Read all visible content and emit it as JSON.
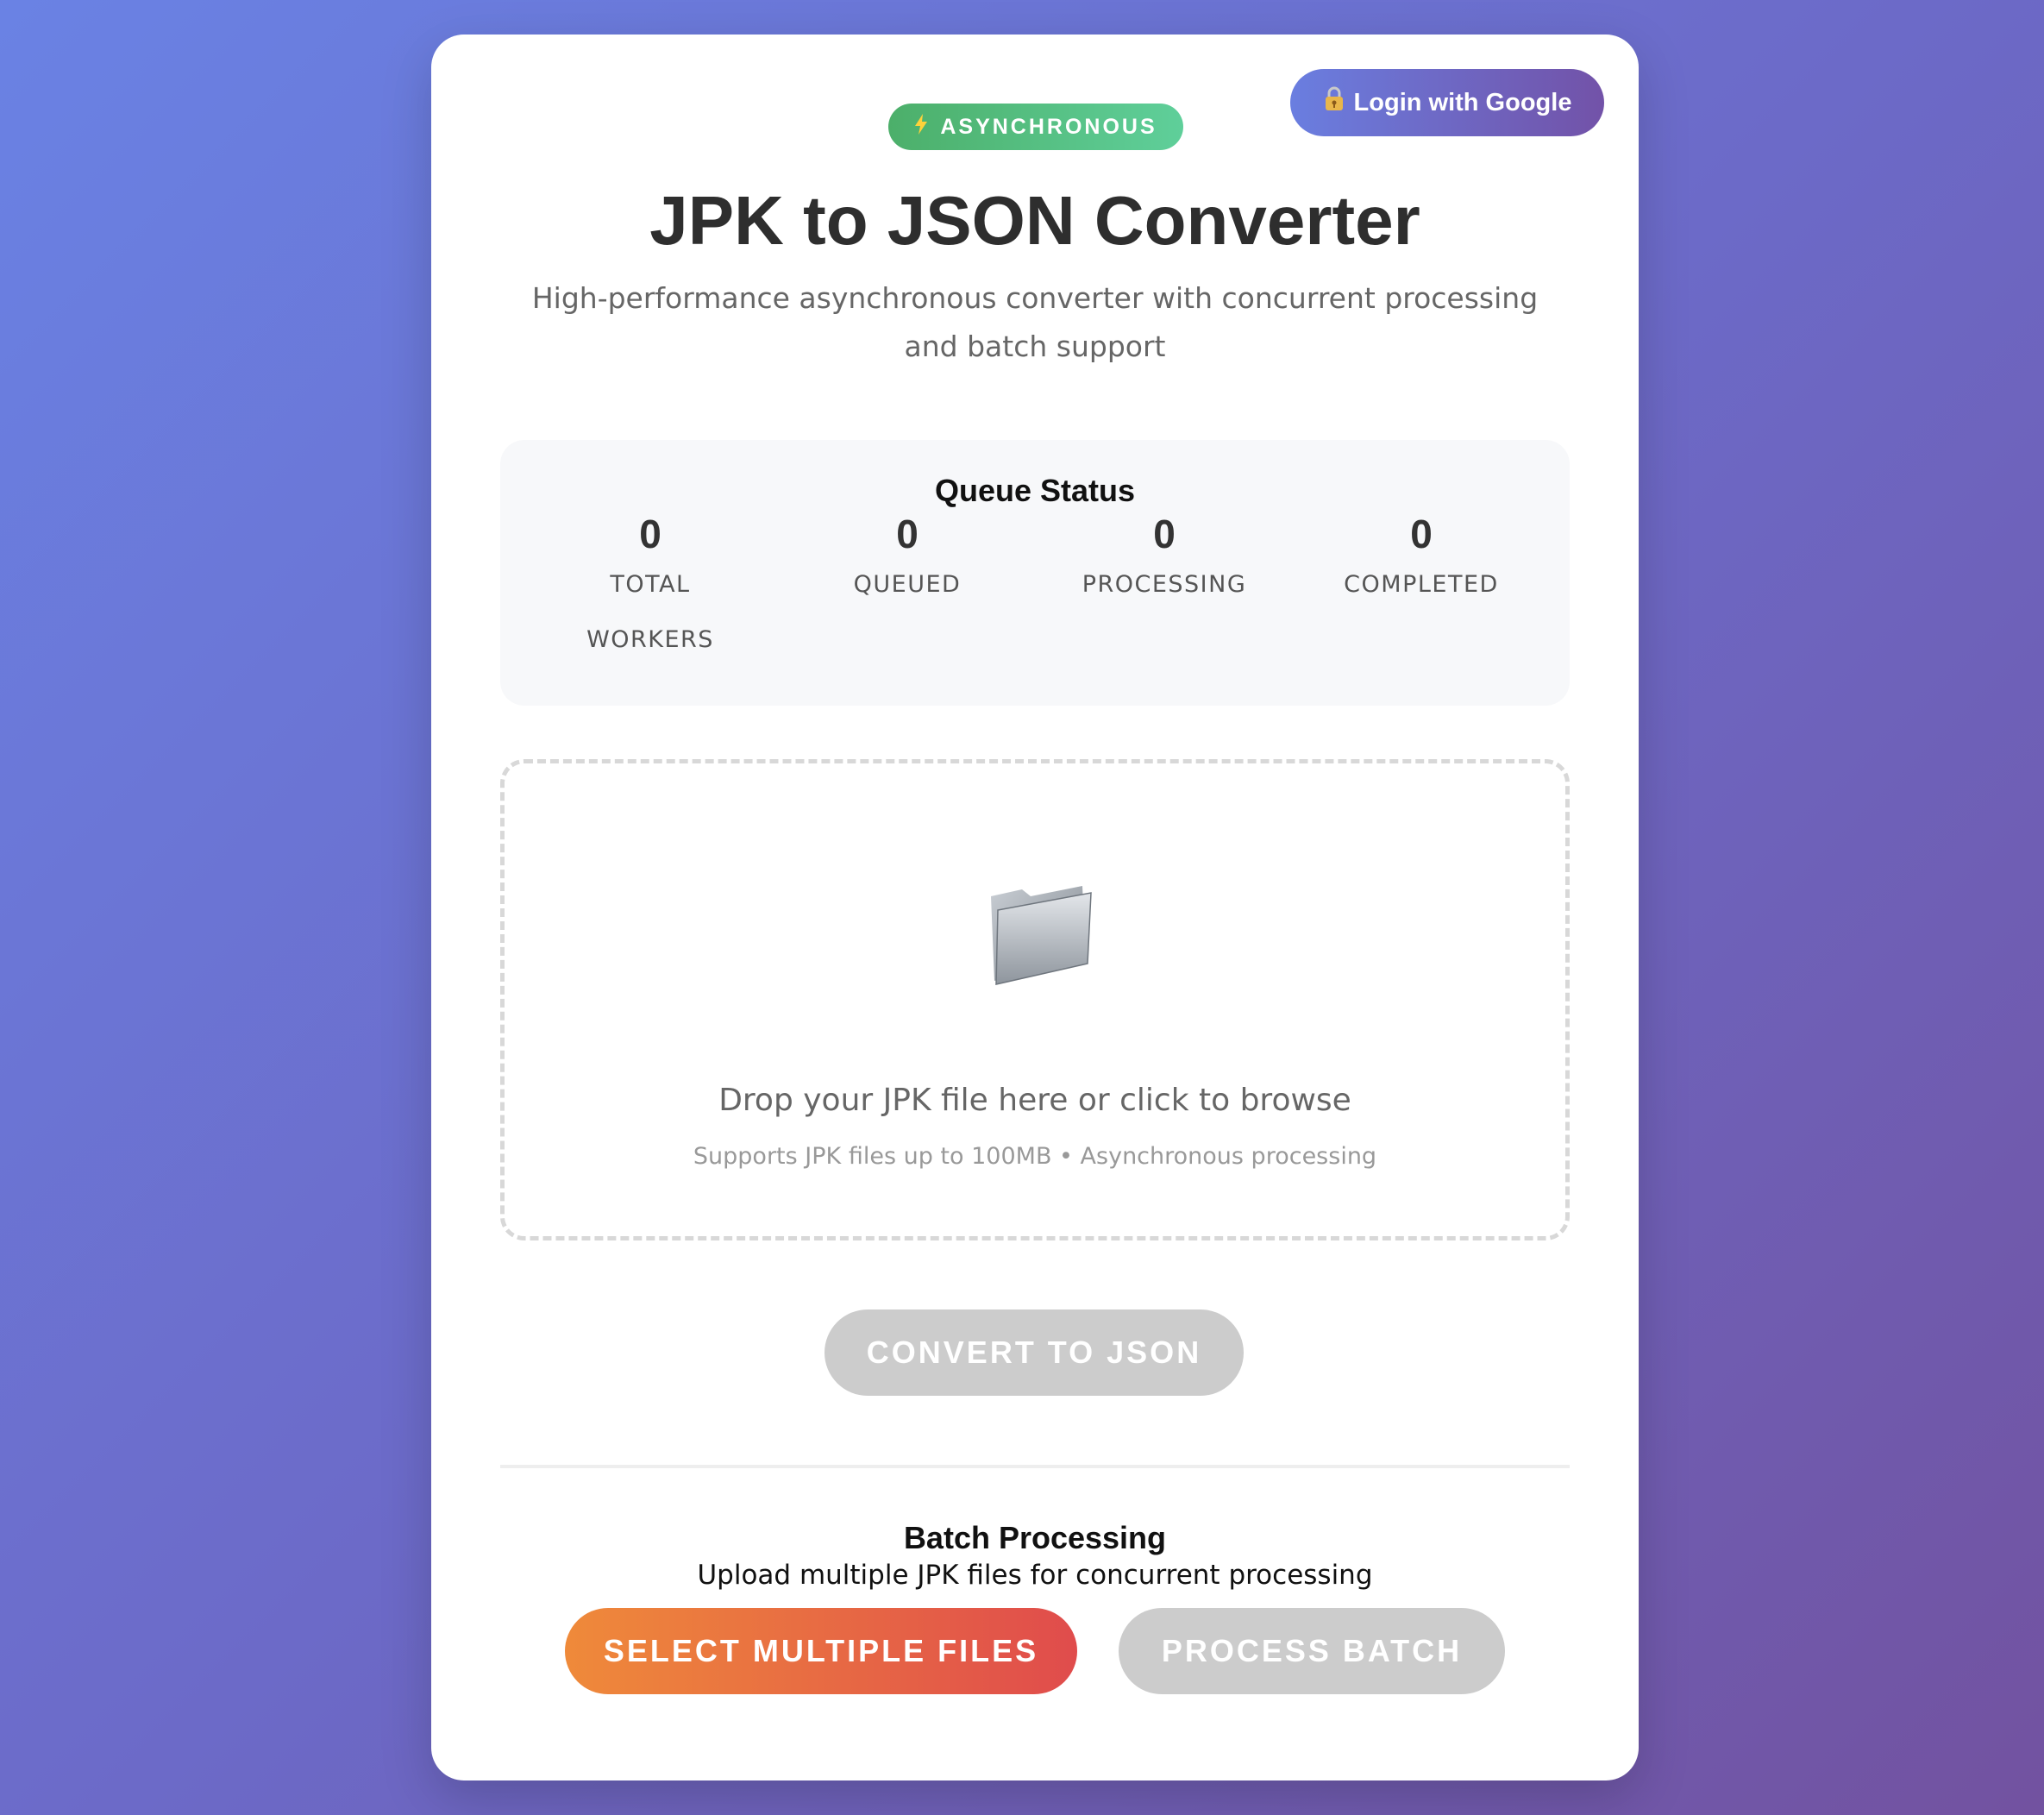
{
  "header": {
    "login_icon": "lock-key-icon",
    "login_label": "Login with Google",
    "badge_icon": "lightning-icon",
    "badge_label": "ASYNCHRONOUS",
    "title": "JPK to JSON Converter",
    "subtitle": "High-performance asynchronous converter with concurrent processing and batch support"
  },
  "queue": {
    "title": "Queue Status",
    "stats": [
      {
        "value": "0",
        "label": "TOTAL WORKERS"
      },
      {
        "value": "0",
        "label": "QUEUED"
      },
      {
        "value": "0",
        "label": "PROCESSING"
      },
      {
        "value": "0",
        "label": "COMPLETED"
      }
    ]
  },
  "dropzone": {
    "icon": "folder-icon",
    "main_text": "Drop your JPK file here or click to browse",
    "sub_text": "Supports JPK files up to 100MB • Asynchronous processing"
  },
  "convert": {
    "label": "CONVERT TO JSON"
  },
  "batch": {
    "title": "Batch Processing",
    "subtitle": "Upload multiple JPK files for concurrent processing",
    "select_label": "SELECT MULTIPLE FILES",
    "process_label": "PROCESS BATCH"
  },
  "colors": {
    "background_start": "#6a82e4",
    "background_end": "#7252a0",
    "badge_green": "#4caf6a",
    "select_orange": "#ef8a3a",
    "select_red": "#e04c4c",
    "disabled_gray": "#cccccc"
  }
}
